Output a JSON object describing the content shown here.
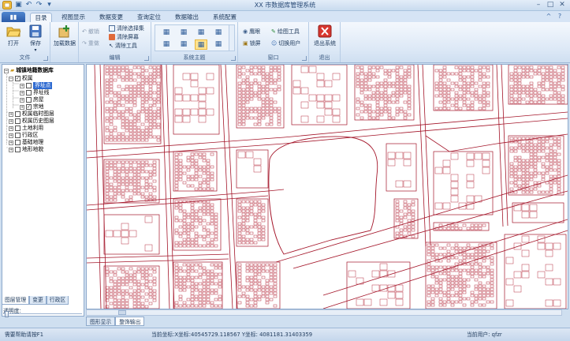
{
  "window": {
    "title": "XX 市数据库管理系统"
  },
  "quick_access": [
    "save-icon",
    "undo-icon",
    "redo-icon",
    "dropdown-icon"
  ],
  "ribbon_tabs": [
    "目录",
    "视图显示",
    "数据变更",
    "查询定位",
    "数据输出",
    "系统配置"
  ],
  "active_tab": "目录",
  "groups": {
    "file": {
      "label": "文件",
      "open": "打开",
      "save": "保存"
    },
    "add_data": {
      "label": "加载数据"
    },
    "edit": {
      "label": "编辑",
      "undo": "撤销",
      "redo": "重做",
      "clear_selection": "清除选择集",
      "clear_screen": "清除屏幕",
      "clear_tool": "清除工具"
    },
    "theme": {
      "label": "系统主题"
    },
    "window": {
      "label": "窗口",
      "eagle_eye": "鹰眼",
      "lock_screen": "锁屏",
      "draw_tools": "绘图工具",
      "switch_user": "切换用户"
    },
    "exit": {
      "label": "退出",
      "exit_system": "退出系统"
    }
  },
  "tree": {
    "root": "城镇地籍数据库",
    "items": [
      {
        "label": "权属",
        "expanded": "−",
        "checked": "✓"
      },
      {
        "label": "界址点",
        "expanded": "+",
        "checked": "",
        "selected": true
      },
      {
        "label": "界址线",
        "expanded": "+",
        "checked": ""
      },
      {
        "label": "房屋",
        "expanded": "+",
        "checked": ""
      },
      {
        "label": "宗地",
        "expanded": "+",
        "checked": "✓"
      },
      {
        "label": "权属临时图层",
        "expanded": "+",
        "checked": ""
      },
      {
        "label": "权属历史图层",
        "expanded": "+",
        "checked": ""
      },
      {
        "label": "土地利用",
        "expanded": "+",
        "checked": ""
      },
      {
        "label": "行政区",
        "expanded": "+",
        "checked": ""
      },
      {
        "label": "基础地理",
        "expanded": "+",
        "checked": ""
      },
      {
        "label": "地形地貌",
        "expanded": "+",
        "checked": ""
      }
    ]
  },
  "left_tabs": [
    "图层管理",
    "变更",
    "行政区"
  ],
  "transparency_label": "透明度:",
  "transparency_value": 0.02,
  "map_tabs": [
    "图形显示",
    "整饰输出"
  ],
  "status": {
    "help": "需要帮助请按F1",
    "coords": "当前坐标:X坐标:40545729.118567  Y坐标: 4081181.31403359",
    "user": "当前用户: qfzr"
  }
}
